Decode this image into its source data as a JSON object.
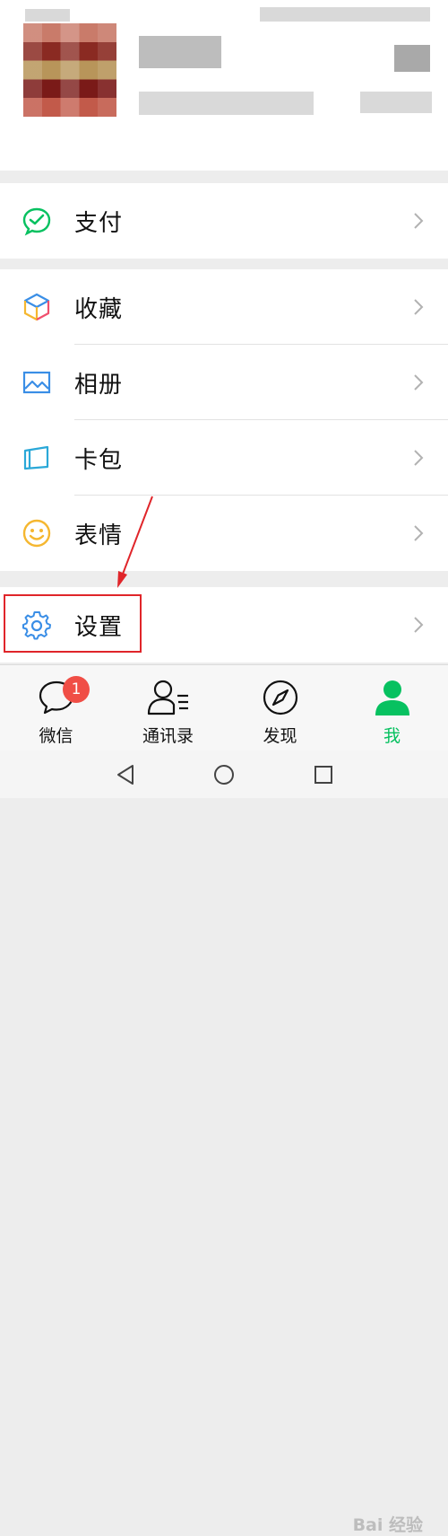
{
  "menu": {
    "pay": "支付",
    "favorites": "收藏",
    "album": "相册",
    "cards": "卡包",
    "stickers": "表情",
    "settings": "设置"
  },
  "tabs": {
    "chats": "微信",
    "chats_badge": "1",
    "contacts": "通讯录",
    "discover": "发现",
    "me": "我"
  },
  "watermark": "Bai 经验",
  "colors": {
    "accent_green": "#07c160",
    "badge_red": "#f04e46",
    "annotation_red": "#e0252a"
  }
}
